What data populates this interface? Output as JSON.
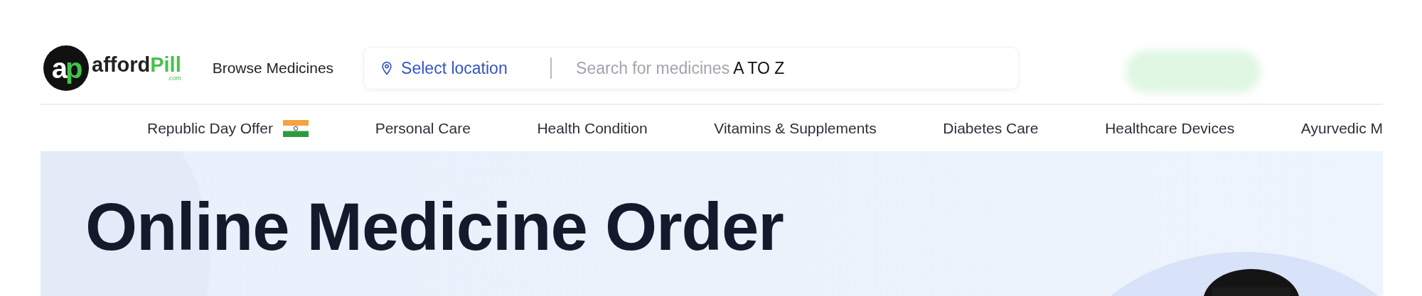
{
  "header": {
    "logo": {
      "badge": [
        "a",
        "p"
      ],
      "name": "afford",
      "accent": "Pill",
      "domain": ".com"
    },
    "browse_link": "Browse Medicines",
    "search": {
      "location": "Select location",
      "prompt": "Search for medicines",
      "keyword": "A TO Z"
    }
  },
  "nav": [
    {
      "label": "Republic Day Offer",
      "kind": "offer"
    },
    {
      "label": "Personal Care",
      "kind": "category"
    },
    {
      "label": "Health Condition",
      "kind": "category"
    },
    {
      "label": "Vitamins & Supplements",
      "kind": "category"
    },
    {
      "label": "Diabetes Care",
      "kind": "category"
    },
    {
      "label": "Healthcare Devices",
      "kind": "category"
    },
    {
      "label": "Ayurvedic M",
      "kind": "category"
    }
  ],
  "hero": {
    "title": "Online Medicine Order"
  }
}
